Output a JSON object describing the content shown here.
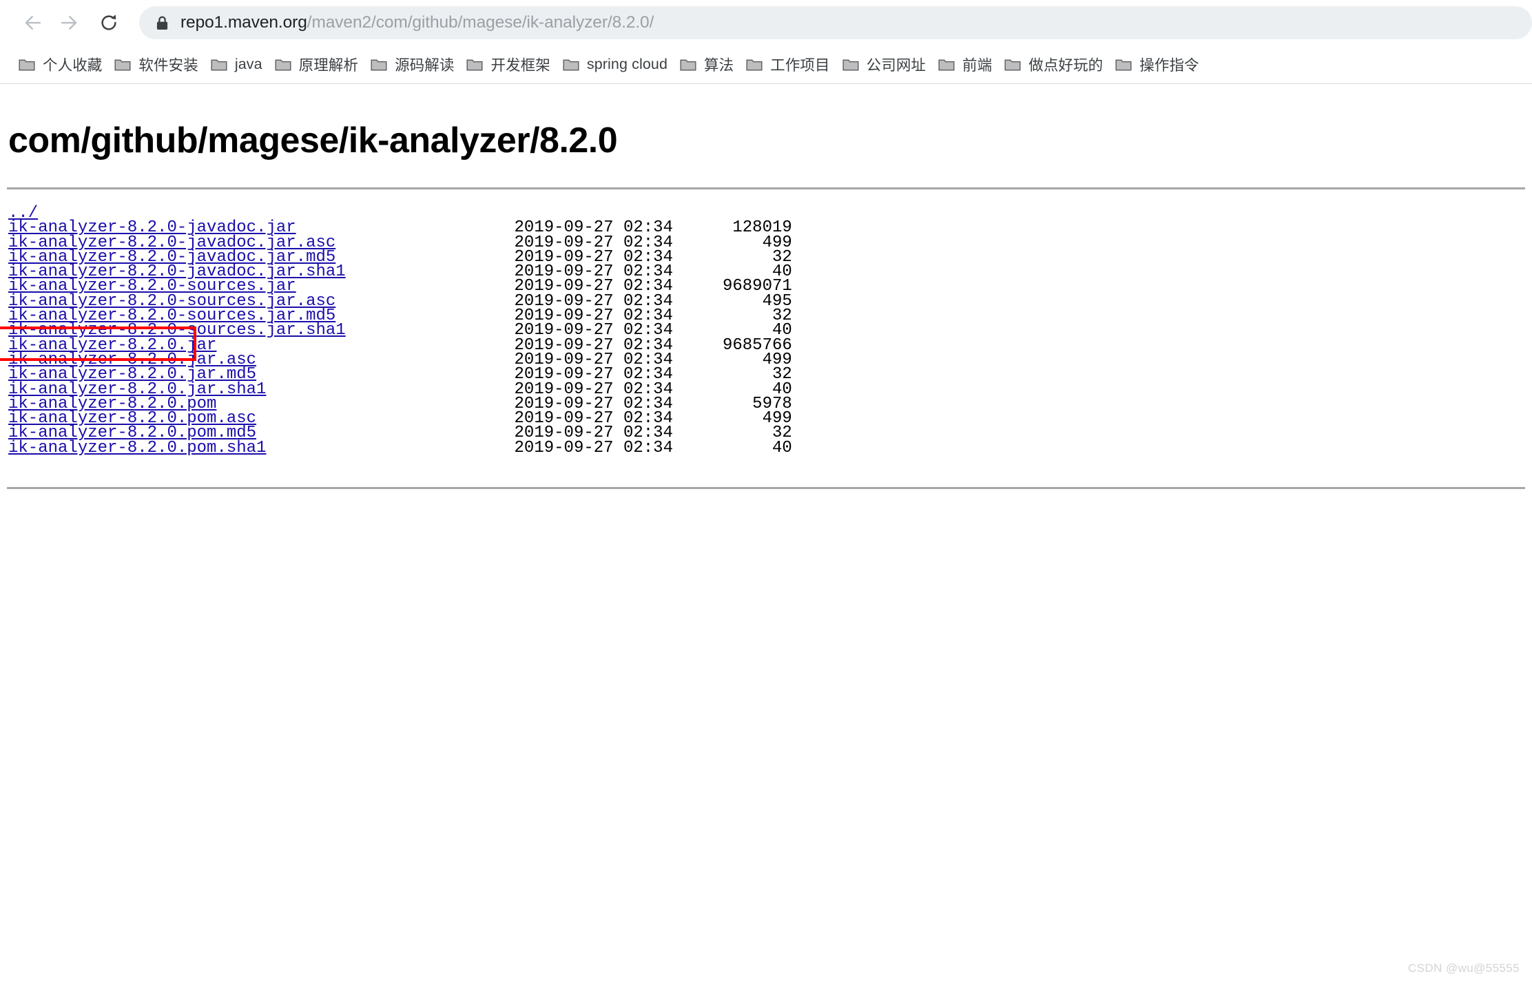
{
  "browser": {
    "back_icon": "arrow-left-icon",
    "forward_icon": "arrow-right-icon",
    "reload_icon": "reload-icon",
    "lock_icon": "lock-icon",
    "url_host": "repo1.maven.org",
    "url_path": "/maven2/com/github/magese/ik-analyzer/8.2.0/",
    "url_full": "repo1.maven.org/maven2/com/github/magese/ik-analyzer/8.2.0/",
    "bookmarks": [
      {
        "label": "个人收藏",
        "icon": "folder-icon"
      },
      {
        "label": "软件安装",
        "icon": "folder-icon"
      },
      {
        "label": "java",
        "icon": "folder-icon"
      },
      {
        "label": "原理解析",
        "icon": "folder-icon"
      },
      {
        "label": "源码解读",
        "icon": "folder-icon"
      },
      {
        "label": "开发框架",
        "icon": "folder-icon"
      },
      {
        "label": "spring cloud",
        "icon": "folder-icon"
      },
      {
        "label": "算法",
        "icon": "folder-icon"
      },
      {
        "label": "工作项目",
        "icon": "folder-icon"
      },
      {
        "label": "公司网址",
        "icon": "folder-icon"
      },
      {
        "label": "前端",
        "icon": "folder-icon"
      },
      {
        "label": "做点好玩的",
        "icon": "folder-icon"
      },
      {
        "label": "操作指令",
        "icon": "folder-icon"
      }
    ]
  },
  "page": {
    "title": "com/github/magese/ik-analyzer/8.2.0",
    "parent_link": "../",
    "files": [
      {
        "name": "ik-analyzer-8.2.0-javadoc.jar",
        "date": "2019-09-27 02:34",
        "size": "128019"
      },
      {
        "name": "ik-analyzer-8.2.0-javadoc.jar.asc",
        "date": "2019-09-27 02:34",
        "size": "499"
      },
      {
        "name": "ik-analyzer-8.2.0-javadoc.jar.md5",
        "date": "2019-09-27 02:34",
        "size": "32"
      },
      {
        "name": "ik-analyzer-8.2.0-javadoc.jar.sha1",
        "date": "2019-09-27 02:34",
        "size": "40"
      },
      {
        "name": "ik-analyzer-8.2.0-sources.jar",
        "date": "2019-09-27 02:34",
        "size": "9689071"
      },
      {
        "name": "ik-analyzer-8.2.0-sources.jar.asc",
        "date": "2019-09-27 02:34",
        "size": "495"
      },
      {
        "name": "ik-analyzer-8.2.0-sources.jar.md5",
        "date": "2019-09-27 02:34",
        "size": "32"
      },
      {
        "name": "ik-analyzer-8.2.0-sources.jar.sha1",
        "date": "2019-09-27 02:34",
        "size": "40"
      },
      {
        "name": "ik-analyzer-8.2.0.jar",
        "date": "2019-09-27 02:34",
        "size": "9685766"
      },
      {
        "name": "ik-analyzer-8.2.0.jar.asc",
        "date": "2019-09-27 02:34",
        "size": "499"
      },
      {
        "name": "ik-analyzer-8.2.0.jar.md5",
        "date": "2019-09-27 02:34",
        "size": "32"
      },
      {
        "name": "ik-analyzer-8.2.0.jar.sha1",
        "date": "2019-09-27 02:34",
        "size": "40"
      },
      {
        "name": "ik-analyzer-8.2.0.pom",
        "date": "2019-09-27 02:34",
        "size": "5978"
      },
      {
        "name": "ik-analyzer-8.2.0.pom.asc",
        "date": "2019-09-27 02:34",
        "size": "499"
      },
      {
        "name": "ik-analyzer-8.2.0.pom.md5",
        "date": "2019-09-27 02:34",
        "size": "32"
      },
      {
        "name": "ik-analyzer-8.2.0.pom.sha1",
        "date": "2019-09-27 02:34",
        "size": "40"
      }
    ],
    "highlighted_file": "ik-analyzer-8.2.0.jar",
    "highlight_color": "#ff0000",
    "link_color": "#1a0dab"
  },
  "watermark": "CSDN @wu@55555"
}
